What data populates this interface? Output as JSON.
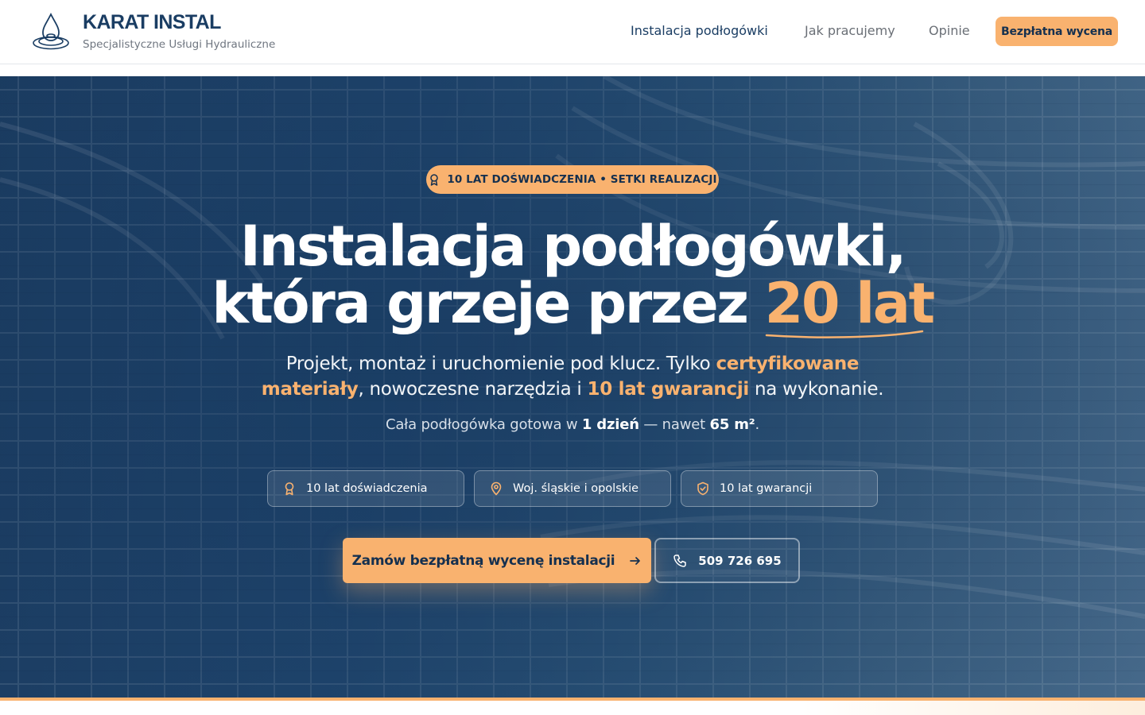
{
  "header": {
    "brand_name": "KARAT INSTAL",
    "brand_tagline": "Specjalistyczne Usługi Hydrauliczne",
    "logo_icon": "water-drop-icon",
    "nav": [
      {
        "label": "Instalacja podłogówki",
        "active": true
      },
      {
        "label": "Jak pracujemy",
        "active": false
      },
      {
        "label": "Opinie",
        "active": false
      }
    ],
    "cta_label": "Bezpłatna wycena"
  },
  "hero": {
    "badge": {
      "icon": "award-icon",
      "text": "10 LAT DOŚWIADCZENIA • SETKI REALIZACJI"
    },
    "headline": {
      "line1": "Instalacja podłogówki,",
      "line2_prefix": "która grzeje przez",
      "line2_accent": "20 lat"
    },
    "lead": {
      "part1": "Projekt, montaż i uruchomienie pod klucz. Tylko ",
      "hl1": "certyfikowane materiały",
      "part2": ", nowoczesne narzędzia i ",
      "hl2": "10 lat gwarancji",
      "part3": " na wykonanie."
    },
    "sub": {
      "part1": "Cała podłogówka gotowa w ",
      "b1": "1 dzień",
      "part2": " — nawet ",
      "b2": "65 m²",
      "part3": "."
    },
    "chips": [
      {
        "icon": "award-icon",
        "label": "10 lat doświadczenia"
      },
      {
        "icon": "map-pin-icon",
        "label": "Woj. śląskie i opolskie"
      },
      {
        "icon": "shield-check-icon",
        "label": "10 lat gwarancji"
      }
    ],
    "primary_button": {
      "label": "Zamów bezpłatną wycenę instalacji",
      "icon": "arrow-right-icon"
    },
    "phone_button": {
      "label": "509 726 695",
      "icon": "phone-icon"
    }
  },
  "colors": {
    "accent": "#f9b26f",
    "navy": "#1a3d63",
    "hero_bg": "#1f456d"
  }
}
